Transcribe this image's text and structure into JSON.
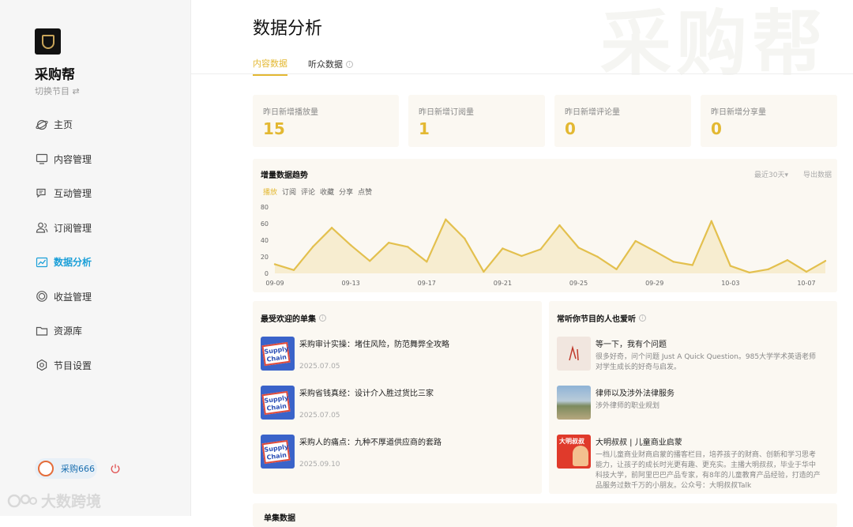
{
  "sidebar": {
    "brand_name": "采购帮",
    "switch_label": "切换节目 ⇄",
    "nav": [
      {
        "label": "主页",
        "icon": "planet-icon"
      },
      {
        "label": "内容管理",
        "icon": "monitor-icon"
      },
      {
        "label": "互动管理",
        "icon": "chat-icon"
      },
      {
        "label": "订阅管理",
        "icon": "users-icon"
      },
      {
        "label": "数据分析",
        "icon": "chart-icon",
        "active": true
      },
      {
        "label": "收益管理",
        "icon": "coin-icon"
      },
      {
        "label": "资源库",
        "icon": "folder-icon"
      },
      {
        "label": "节目设置",
        "icon": "settings-icon"
      }
    ],
    "user_name": "采购666",
    "watermark": "大数跨境"
  },
  "main": {
    "title": "数据分析",
    "bg_watermark": "采购帮",
    "tabs": [
      {
        "label": "内容数据",
        "active": true
      },
      {
        "label": "听众数据",
        "info": "i"
      }
    ],
    "stats": [
      {
        "label": "昨日新增播放量",
        "value": "15"
      },
      {
        "label": "昨日新增订阅量",
        "value": "1"
      },
      {
        "label": "昨日新增评论量",
        "value": "0"
      },
      {
        "label": "昨日新增分享量",
        "value": "0"
      }
    ],
    "trend": {
      "title": "增量数据趋势",
      "range_label": "最近30天▾",
      "export_label": "导出数据",
      "metric_tabs": [
        "播放",
        "订阅",
        "评论",
        "收藏",
        "分享",
        "点赞"
      ]
    },
    "popular": {
      "title": "最受欢迎的单集",
      "info": "i",
      "items": [
        {
          "title": "采购审计实操：堵住风险，防范舞弊全攻略",
          "date": "2025.07.05",
          "thumb_text": "Supply Chain"
        },
        {
          "title": "采购省钱真经：设计介入胜过货比三家",
          "date": "2025.07.05",
          "thumb_text": "Supply Chain"
        },
        {
          "title": "采购人的痛点：九种不厚道供应商的套路",
          "date": "2025.09.10",
          "thumb_text": "Supply Chain"
        }
      ]
    },
    "also_like": {
      "title": "常听你节目的人也爱听",
      "info": "i",
      "items": [
        {
          "title": "等一下，我有个问题",
          "desc": "很多好奇，问个问题 Just A Quick Question。985大学学术英语老师对学生成长的好奇与启发。"
        },
        {
          "title": "律师以及涉外法律服务",
          "desc": "涉外律师的职业规划"
        },
        {
          "title": "大明叔叔 | 儿童商业启蒙",
          "desc": "一档儿童商业财商启蒙的播客栏目，培养孩子的财商、创新和学习思考能力，让孩子的成长时光更有趣、更充实。主播大明叔叔，毕业于华中科技大学，前阿里巴巴产品专家，有8年的儿童教育产品经验，打造的产品服务过数千万的小朋友。公众号：大明叔叔Talk",
          "thumb_text": "大明叔叔"
        }
      ]
    },
    "bottom_title": "单集数据"
  },
  "chart_data": {
    "type": "area",
    "ylim": [
      0,
      80
    ],
    "yticks": [
      0,
      20,
      40,
      60,
      80
    ],
    "x": [
      "09-09",
      "09-10",
      "09-11",
      "09-12",
      "09-13",
      "09-14",
      "09-15",
      "09-16",
      "09-17",
      "09-18",
      "09-19",
      "09-20",
      "09-21",
      "09-22",
      "09-23",
      "09-24",
      "09-25",
      "09-26",
      "09-27",
      "09-28",
      "09-29",
      "09-30",
      "10-01",
      "10-02",
      "10-03",
      "10-04",
      "10-05",
      "10-06",
      "10-07",
      "10-08"
    ],
    "xtick_labels": [
      "09-09",
      "09-13",
      "09-17",
      "09-21",
      "09-25",
      "09-29",
      "10-03",
      "10-07"
    ],
    "series": [
      {
        "values": [
          11,
          4,
          32,
          55,
          34,
          15,
          37,
          32,
          14,
          65,
          42,
          2,
          30,
          21,
          29,
          58,
          31,
          20,
          5,
          39,
          27,
          14,
          10,
          63,
          9,
          1,
          5,
          16,
          2,
          15
        ]
      }
    ],
    "colors": {
      "line": "#e3c04e",
      "fill": "#f7edd0"
    }
  }
}
